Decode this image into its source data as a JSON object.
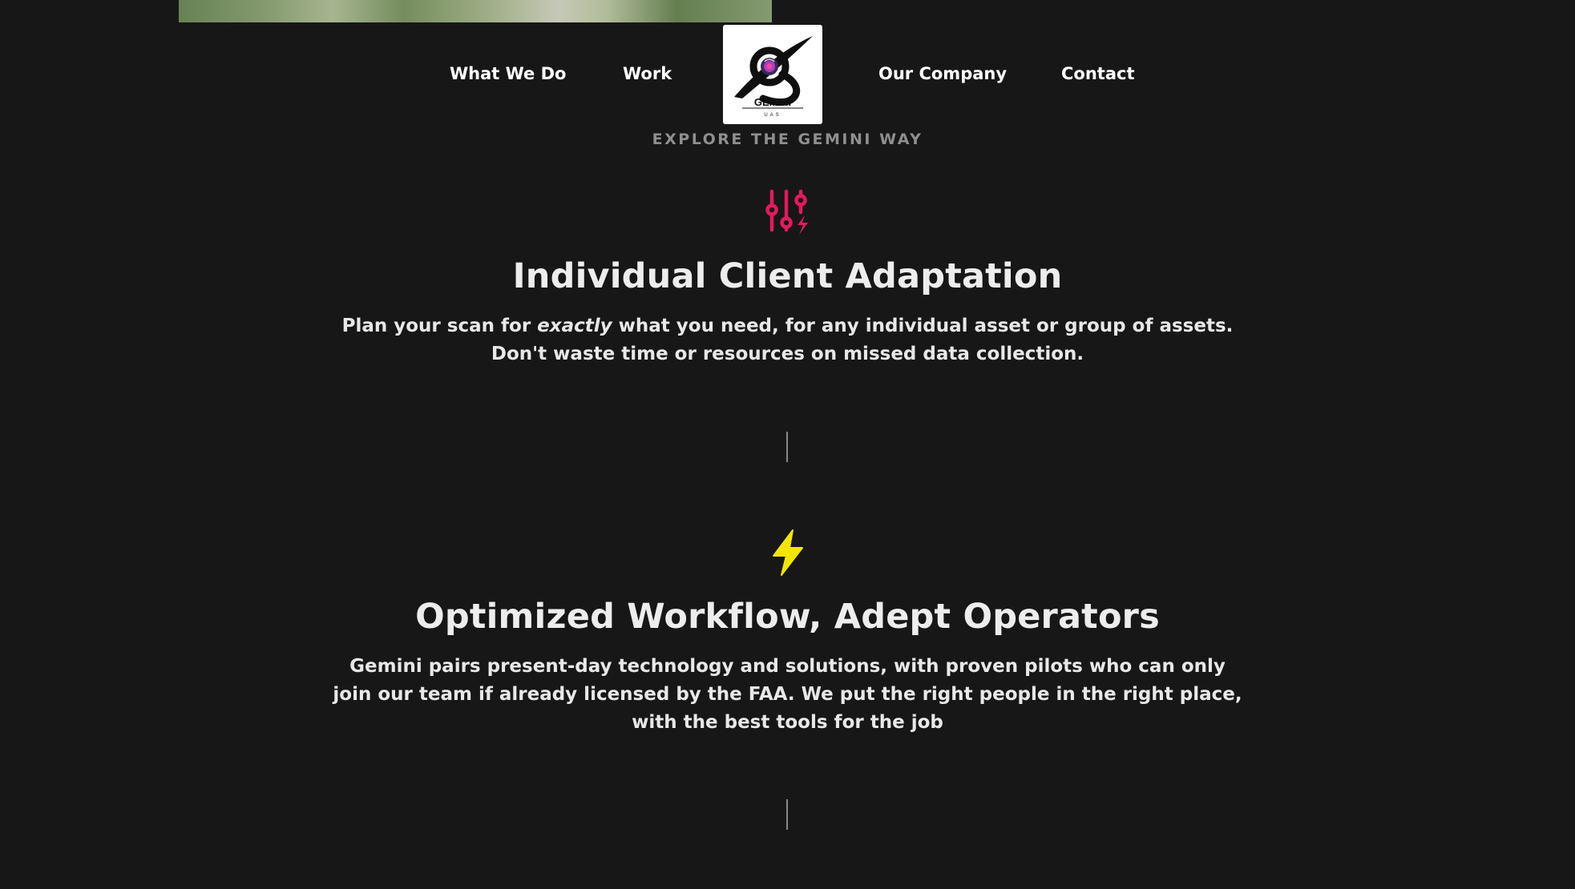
{
  "nav": {
    "items": [
      {
        "label": "What We Do"
      },
      {
        "label": "Work"
      },
      {
        "label": "Our Company"
      },
      {
        "label": "Contact"
      }
    ],
    "logo": {
      "wordmark": "GEMINI",
      "sub": "UAS"
    }
  },
  "eyebrow": "EXPLORE THE GEMINI WAY",
  "features": [
    {
      "icon": "sliders-bolt-icon",
      "icon_color": "#e5195f",
      "title": "Individual Client Adaptation",
      "text_before": "Plan your scan for ",
      "text_em": "exactly",
      "text_after": " what you need, for any individual asset or group of assets. Don't waste time or resources on missed data collection."
    },
    {
      "icon": "lightning-bolt-icon",
      "icon_color": "#f2e600",
      "title": "Optimized Workflow, Adept Operators",
      "text": "Gemini pairs present-day technology and solutions, with proven pilots who can only join our team if already licensed by the FAA. We put the right people in the right place, with the best tools for the job"
    }
  ],
  "colors": {
    "background": "#171717",
    "text": "#ededed",
    "muted": "#8f8f8f",
    "accent_pink": "#e5195f",
    "accent_yellow": "#f2e600"
  }
}
